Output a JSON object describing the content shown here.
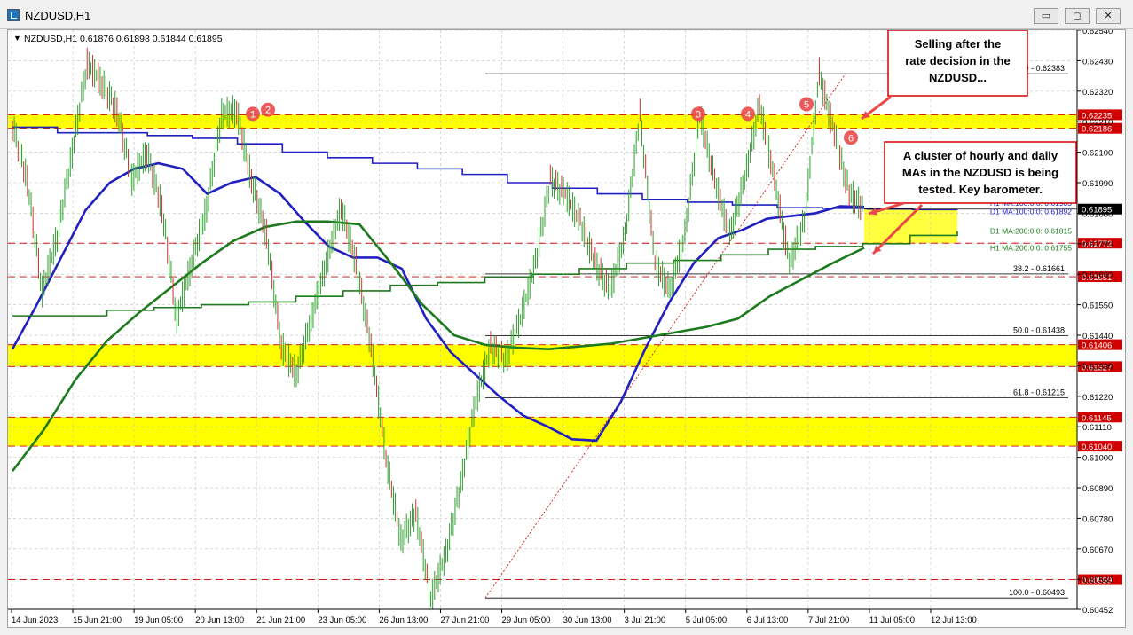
{
  "window": {
    "title": "NZDUSD,H1",
    "buttons": {
      "minimize": "▭",
      "restore": "◻",
      "close": "✕"
    }
  },
  "chart_info": {
    "marker": "▼",
    "text": "NZDUSD,H1  0.61876 0.61898 0.61844 0.61895"
  },
  "colors": {
    "zone": "#ffff00",
    "red_level": "#d00000",
    "ma_blue": "#2020c0",
    "ma_green": "#1e7a1e",
    "candle": "#2e9e2e",
    "candle_down": "#cc3333",
    "callout_border": "#d00000",
    "current_price_bg": "#000000"
  },
  "chart_data": {
    "type": "line",
    "symbol": "NZDUSD",
    "timeframe": "H1",
    "ylim": [
      0.60452,
      0.6254
    ],
    "yticks": [
      "0.62540",
      "0.62430",
      "0.62320",
      "0.62210",
      "0.62100",
      "0.61990",
      "0.61880",
      "0.61770",
      "0.61660",
      "0.61550",
      "0.61440",
      "0.61330",
      "0.61220",
      "0.61110",
      "0.61000",
      "0.60890",
      "0.60780",
      "0.60670",
      "0.60560",
      "0.60452"
    ],
    "xticks": [
      "14 Jun 2023",
      "15 Jun 21:00",
      "19 Jun 05:00",
      "20 Jun 13:00",
      "21 Jun 21:00",
      "23 Jun 05:00",
      "26 Jun 13:00",
      "27 Jun 21:00",
      "29 Jun 05:00",
      "30 Jun 13:00",
      "3 Jul 21:00",
      "5 Jul 05:00",
      "6 Jul 13:00",
      "7 Jul 21:00",
      "11 Jul 05:00",
      "12 Jul 13:00"
    ],
    "zones": [
      [
        0.62186,
        0.62235
      ],
      [
        0.61327,
        0.61406
      ],
      [
        0.6104,
        0.61145
      ],
      [
        0.61772,
        0.61895
      ]
    ],
    "red_levels": [
      {
        "value": 0.62235,
        "label": "0.62235"
      },
      {
        "value": 0.62186,
        "label": "0.62186"
      },
      {
        "value": 0.61772,
        "label": "0.61772"
      },
      {
        "value": 0.61651,
        "label": "0.61651"
      },
      {
        "value": 0.61406,
        "label": "0.61406"
      },
      {
        "value": 0.61327,
        "label": "0.61327"
      },
      {
        "value": 0.61145,
        "label": "0.61145"
      },
      {
        "value": 0.6104,
        "label": "0.61040"
      },
      {
        "value": 0.60559,
        "label": "0.60559"
      }
    ],
    "current_price": {
      "value": 0.61895,
      "label": "0.61895"
    },
    "fibonacci": [
      {
        "value": 0.62383,
        "label": "0.0 - 0.62383"
      },
      {
        "value": 0.61661,
        "label": "38.2 - 0.61661"
      },
      {
        "value": 0.61438,
        "label": "50.0 - 0.61438"
      },
      {
        "value": 0.61215,
        "label": "61.8 - 0.61215"
      },
      {
        "value": 0.60493,
        "label": "100.0 - 0.60493"
      }
    ],
    "ma_labels": [
      {
        "text": "H1 MA:100:0:0: 0.61903",
        "value": 0.61903,
        "color": "#2020c0"
      },
      {
        "text": "D1 MA:100:0:0: 0.61892",
        "value": 0.61892,
        "color": "#2020c0"
      },
      {
        "text": "D1 MA:200:0:0: 0.61815",
        "value": 0.61815,
        "color": "#1e7a1e"
      },
      {
        "text": "H1 MA:200:0:0: 0.61755",
        "value": 0.61755,
        "color": "#1e7a1e"
      }
    ],
    "swing_markers": [
      {
        "label": "1",
        "value": 0.62235
      },
      {
        "label": "2",
        "value": 0.6225
      },
      {
        "label": "3",
        "value": 0.62235
      },
      {
        "label": "4",
        "value": 0.62235
      },
      {
        "label": "5",
        "value": 0.6227
      },
      {
        "label": "6",
        "value": 0.62165
      }
    ],
    "series": [
      {
        "name": "H1 MA 100",
        "color": "#2020c0",
        "values": [
          0.6139,
          0.6155,
          0.6172,
          0.6189,
          0.6199,
          0.6204,
          0.6206,
          0.6204,
          0.6195,
          0.6199,
          0.6201,
          0.6195,
          0.6185,
          0.6176,
          0.6172,
          0.6172,
          0.6168,
          0.615,
          0.6138,
          0.613,
          0.6122,
          0.6115,
          0.6111,
          0.61065,
          0.6106,
          0.612,
          0.6139,
          0.6156,
          0.617,
          0.6179,
          0.6182,
          0.6186,
          0.6187,
          0.6188,
          0.61905,
          0.61903
        ]
      },
      {
        "name": "H1 MA 200",
        "color": "#1e7a1e",
        "values": [
          0.6095,
          0.611,
          0.6128,
          0.6142,
          0.6152,
          0.6161,
          0.617,
          0.6178,
          0.6183,
          0.6185,
          0.6185,
          0.6184,
          0.617,
          0.6155,
          0.6144,
          0.61405,
          0.61395,
          0.6139,
          0.614,
          0.6141,
          0.6143,
          0.6145,
          0.6147,
          0.615,
          0.6158,
          0.6164,
          0.617,
          0.61755
        ]
      },
      {
        "name": "D1 MA 100",
        "color": "#2020c0",
        "values": [
          0.6219,
          0.6217,
          0.6217,
          0.6216,
          0.6215,
          0.6213,
          0.621,
          0.6208,
          0.6206,
          0.6204,
          0.6202,
          0.6199,
          0.6197,
          0.6195,
          0.6193,
          0.6192,
          0.6191,
          0.619,
          0.61898,
          0.61895,
          0.61893,
          0.61892
        ]
      },
      {
        "name": "D1 MA 200",
        "color": "#1e7a1e",
        "values": [
          0.6151,
          0.6151,
          0.6153,
          0.6154,
          0.6155,
          0.6156,
          0.6158,
          0.616,
          0.6162,
          0.6163,
          0.6165,
          0.6166,
          0.6168,
          0.617,
          0.6171,
          0.6173,
          0.6175,
          0.6176,
          0.6177,
          0.618,
          0.61815
        ]
      },
      {
        "name": "Price",
        "color": "#2e9e2e",
        "values": [
          0.622,
          0.62,
          0.616,
          0.618,
          0.621,
          0.6242,
          0.6235,
          0.6225,
          0.62,
          0.621,
          0.619,
          0.615,
          0.617,
          0.619,
          0.62235,
          0.6225,
          0.62,
          0.618,
          0.614,
          0.613,
          0.615,
          0.617,
          0.619,
          0.617,
          0.614,
          0.61,
          0.607,
          0.608,
          0.60493,
          0.6065,
          0.609,
          0.612,
          0.614,
          0.6135,
          0.615,
          0.617,
          0.62,
          0.6195,
          0.6185,
          0.617,
          0.616,
          0.618,
          0.62235,
          0.617,
          0.616,
          0.618,
          0.62235,
          0.62,
          0.618,
          0.62,
          0.6227,
          0.62,
          0.617,
          0.6185,
          0.62383,
          0.62165,
          0.6195,
          0.61895
        ]
      }
    ]
  },
  "callouts": [
    {
      "text": "Selling after the rate decision in the NZDUSD..."
    },
    {
      "text": "A cluster of hourly and daily MAs in the NZDUSD is being tested. Key barometer."
    }
  ]
}
